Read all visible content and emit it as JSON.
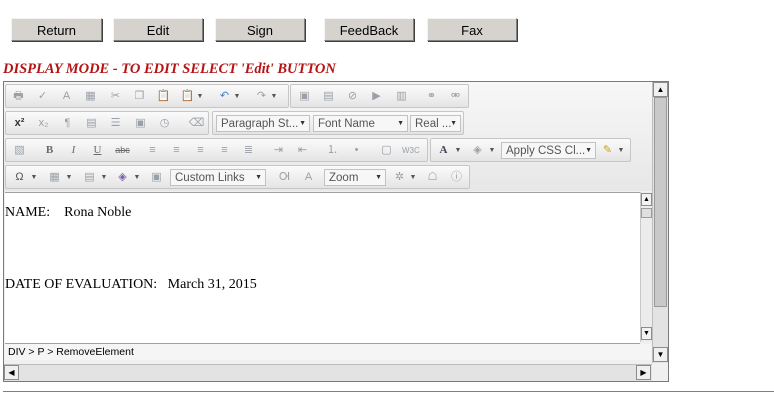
{
  "top_buttons": {
    "return_label": "Return",
    "edit_label": "Edit",
    "sign_label": "Sign",
    "feedback_label": "FeedBack",
    "fax_label": "Fax"
  },
  "mode_message": "DISPLAY MODE - TO EDIT SELECT 'Edit' BUTTON",
  "toolbar": {
    "paragraph_style": "Paragraph St...",
    "font_name": "Font Name",
    "font_size": "Real ...",
    "apply_css_class": "Apply CSS Cl...",
    "custom_links": "Custom Links",
    "zoom": "Zoom"
  },
  "content": {
    "name_line": "NAME:    Rona Noble",
    "date_line": "DATE OF EVALUATION:   March 31, 2015"
  },
  "status_path": "DIV > P > RemoveElement"
}
